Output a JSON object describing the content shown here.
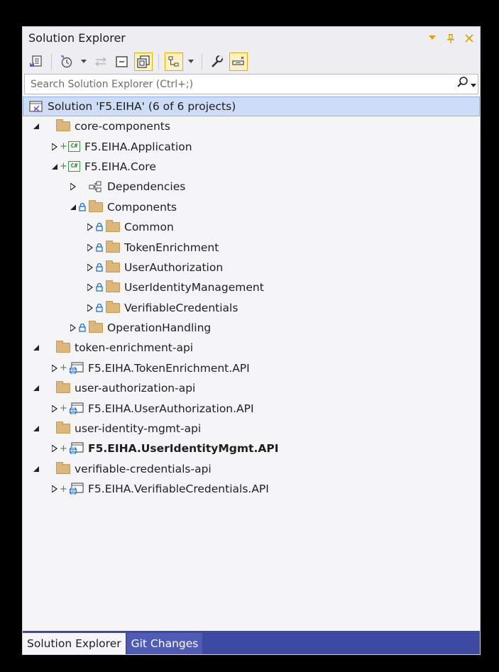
{
  "window": {
    "title": "Solution Explorer"
  },
  "search": {
    "placeholder": "Search Solution Explorer (Ctrl+;)"
  },
  "toolbar": {
    "buttons": [
      "home-icon",
      "history-icon",
      "sync-icon",
      "collapse-all-icon",
      "show-all-files-icon",
      "view-switch-icon",
      "properties-icon",
      "preview-icon"
    ]
  },
  "tree": {
    "solution": "Solution 'F5.EIHA' (6 of 6 projects)",
    "core_components": "core-components",
    "app_project": "F5.EIHA.Application",
    "core_project": "F5.EIHA.Core",
    "dependencies": "Dependencies",
    "components": "Components",
    "common": "Common",
    "token_enrichment": "TokenEnrichment",
    "user_authorization": "UserAuthorization",
    "user_identity_management": "UserIdentityManagement",
    "verifiable_credentials": "VerifiableCredentials",
    "operation_handling": "OperationHandling",
    "token_enrichment_api_folder": "token-enrichment-api",
    "token_enrichment_api_project": "F5.EIHA.TokenEnrichment.API",
    "user_authorization_api_folder": "user-authorization-api",
    "user_authorization_api_project": "F5.EIHA.UserAuthorization.API",
    "user_identity_mgmt_api_folder": "user-identity-mgmt-api",
    "user_identity_mgmt_api_project": "F5.EIHA.UserIdentityMgmt.API",
    "verifiable_credentials_api_folder": "verifiable-credentials-api",
    "verifiable_credentials_api_project": "F5.EIHA.VerifiableCredentials.API"
  },
  "tabs": {
    "solution_explorer": "Solution Explorer",
    "git_changes": "Git Changes"
  },
  "colors": {
    "accent": "#3e4aa1",
    "selection": "#cddcf7",
    "folder": "#dcb67a",
    "added": "#2d9b2d",
    "lock": "#1f6fd1"
  }
}
